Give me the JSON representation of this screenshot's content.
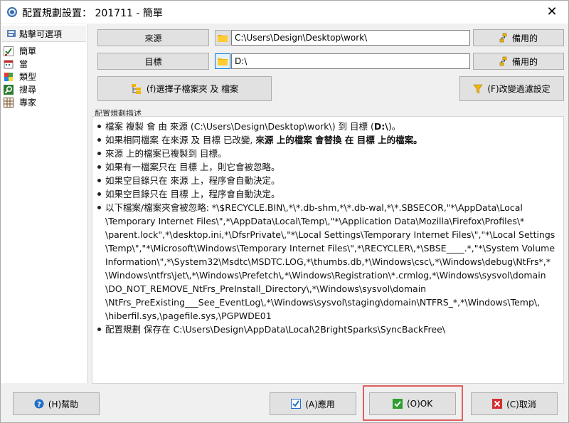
{
  "window": {
    "title": "配置規劃設置： 201711 - 簡單",
    "close_glyph": "✕"
  },
  "sidebar": {
    "header": "點擊可選項",
    "items": [
      {
        "label": "簡單",
        "icon": "check-chart-icon",
        "color": "#2e7d32"
      },
      {
        "label": "當",
        "icon": "calendar-icon",
        "color": "#c62828"
      },
      {
        "label": "類型",
        "icon": "puzzle-icon",
        "color": "#e53935"
      },
      {
        "label": "搜尋",
        "icon": "magnifier-icon",
        "color": "#2e7d32"
      },
      {
        "label": "專家",
        "icon": "grid-icon",
        "color": "#6d4c41"
      }
    ]
  },
  "source": {
    "label": "來源",
    "path": "C:\\Users\\Design\\Desktop\\work\\",
    "spare_label": "備用的"
  },
  "target": {
    "label": "目標",
    "path": "D:\\",
    "spare_label": "備用的"
  },
  "actions": {
    "select_subfolders": "(f)選擇子檔案夾 及 檔案",
    "change_filter": "(F)改變過濾設定"
  },
  "description": {
    "label": "配置規劃描述",
    "lines": [
      {
        "parts": [
          {
            "text": "檔案 複製 會 由 來源 (C:\\Users\\Design\\Desktop\\work\\) 到 目標 (",
            "bold": false
          },
          {
            "text": "D:\\",
            "bold": true
          },
          {
            "text": ")。",
            "bold": false
          }
        ]
      },
      {
        "parts": [
          {
            "text": "如果相同檔案 在來源 及 目標 已改變, ",
            "bold": false
          },
          {
            "text": "來源 上的檔案 會替換 在 目標 上的檔案。",
            "bold": true
          }
        ]
      },
      {
        "parts": [
          {
            "text": "來源 上的檔案已複製到 目標。",
            "bold": false
          }
        ]
      },
      {
        "parts": [
          {
            "text": "如果有一檔案只在 目標 上，則它會被忽略。",
            "bold": false
          }
        ]
      },
      {
        "parts": [
          {
            "text": "如果空目錄只在 來源 上，程序會自動決定。",
            "bold": false
          }
        ]
      },
      {
        "parts": [
          {
            "text": "如果空目錄只在 目標 上，程序會自動決定。",
            "bold": false
          }
        ]
      },
      {
        "wrapped": [
          "以下檔案/檔案夾會被忽略:  *\\$RECYCLE.BIN\\,*\\*.db-shm,*\\*.db-wal,*\\*.SBSECOR,\"*\\AppData\\Local",
          "\\Temporary Internet Files\\\",*\\AppData\\Local\\Temp\\,\"*\\Application Data\\Mozilla\\Firefox\\Profiles\\*",
          "\\parent.lock\",*\\desktop.ini,*\\DfsrPrivate\\,\"*\\Local Settings\\Temporary Internet Files\\\",\"*\\Local Settings",
          "\\Temp\\\",\"*\\Microsoft\\Windows\\Temporary Internet Files\\\",*\\RECYCLER\\,*\\SBSE____.*,\"*\\System Volume",
          "Information\\\",*\\System32\\Msdtc\\MSDTC.LOG,*\\thumbs.db,*\\Windows\\csc\\,*\\Windows\\debug\\NtFrs*,*",
          "\\Windows\\ntfrs\\jet\\,*\\Windows\\Prefetch\\,*\\Windows\\Registration\\*.crmlog,*\\Windows\\sysvol\\domain",
          "\\DO_NOT_REMOVE_NtFrs_PreInstall_Directory\\,*\\Windows\\sysvol\\domain",
          "\\NtFrs_PreExisting___See_EventLog\\,*\\Windows\\sysvol\\staging\\domain\\NTFRS_*,*\\Windows\\Temp\\,",
          "\\hiberfil.sys,\\pagefile.sys,\\PGPWDE01"
        ]
      },
      {
        "parts": [
          {
            "text": "配置規劃 保存在 C:\\Users\\Design\\AppData\\Local\\2BrightSparks\\SyncBackFree\\",
            "bold": false
          }
        ]
      }
    ]
  },
  "footer": {
    "help": "(H)幫助",
    "apply": "(A)應用",
    "ok": "(O)OK",
    "cancel": "(C)取消"
  },
  "colors": {
    "folder": "#f2b400",
    "ok_highlight": "#e06060",
    "help_blue": "#1e6fc8",
    "cancel_red": "#d32f2f",
    "ok_green": "#2e9e2e"
  }
}
